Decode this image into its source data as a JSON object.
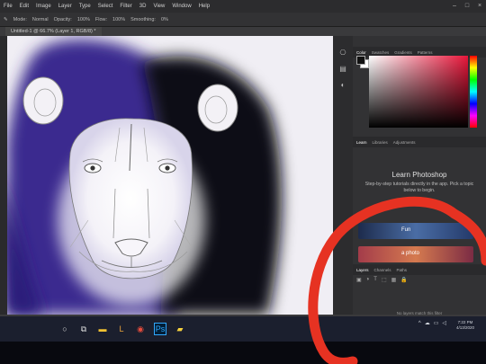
{
  "menubar": {
    "items": [
      "File",
      "Edit",
      "Image",
      "Layer",
      "Type",
      "Select",
      "Filter",
      "3D",
      "View",
      "Window",
      "Help"
    ]
  },
  "options_bar": {
    "items": [
      "Mode:",
      "Normal",
      "Opacity:",
      "100%",
      "Flow:",
      "100%",
      "Smoothing:",
      "0%"
    ]
  },
  "document": {
    "tab_label": "Untitled-1 @ 66.7% (Layer 1, RGB/8) *"
  },
  "window_controls": {
    "minimize": "–",
    "maximize": "□",
    "close": "×"
  },
  "right_panel": {
    "color_tabs": [
      "Color",
      "Swatches",
      "Gradients",
      "Patterns"
    ],
    "learn_tabs": [
      "Learn",
      "Libraries",
      "Adjustments"
    ],
    "learn_title": "Learn Photoshop",
    "learn_desc": "Step-by-step tutorials directly in the app. Pick a topic below to begin.",
    "cards": [
      {
        "label": "Fun"
      },
      {
        "label": "a photo"
      }
    ],
    "layers_tabs": [
      "Layers",
      "Channels",
      "Paths"
    ],
    "layers_empty": "No layers match this filter"
  },
  "taskbar": {
    "icons": [
      "search-icon",
      "task-view-icon",
      "file-explorer-icon",
      "lightroom-icon",
      "chrome-icon",
      "photoshop-icon",
      "sticky-notes-icon"
    ],
    "tray_icons": [
      "up-chevron-icon",
      "cloud-icon",
      "network-icon",
      "volume-icon",
      "notification-icon"
    ],
    "clock_time": "7:22 PM",
    "clock_date": "4/13/2020"
  },
  "colors": {
    "ps_chrome": "#2c2c2e",
    "canvas_bg": "#f0eef4",
    "mane_blue": "#3a2a8f",
    "mane_dark": "#0b0b14",
    "annotation_red": "#e63222",
    "taskbar": "#1b1f2e"
  }
}
